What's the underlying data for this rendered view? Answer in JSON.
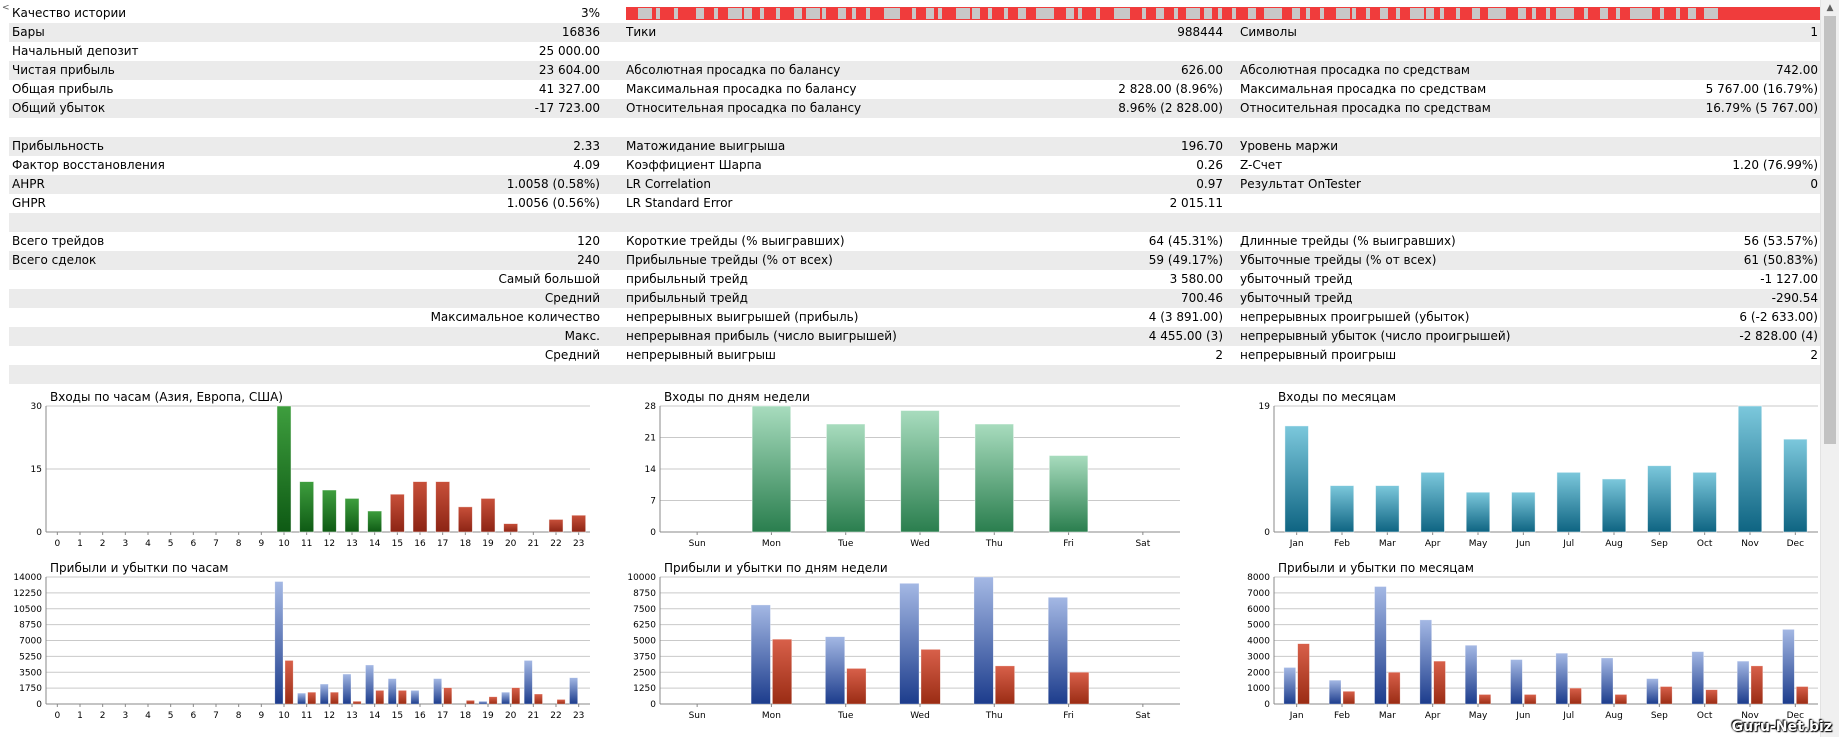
{
  "colors": {
    "quality_red": "#f03c3c",
    "quality_gray": "#c8c8c8"
  },
  "summary": {
    "history_quality_label": "Качество истории",
    "history_quality_value": "3%",
    "rows": [
      {
        "alt": true,
        "l1": "Бары",
        "v1": "16836",
        "l2": "Тики",
        "v2": "988444",
        "l3": "Символы",
        "v3": "1"
      },
      {
        "alt": false,
        "l1": "Начальный депозит",
        "v1": "25 000.00",
        "l2": "",
        "v2": "",
        "l3": "",
        "v3": ""
      },
      {
        "alt": true,
        "l1": "Чистая прибыль",
        "v1": "23 604.00",
        "l2": "Абсолютная просадка по балансу",
        "v2": "626.00",
        "l3": "Абсолютная просадка по средствам",
        "v3": "742.00"
      },
      {
        "alt": false,
        "l1": "Общая прибыль",
        "v1": "41 327.00",
        "l2": "Максимальная просадка по балансу",
        "v2": "2 828.00 (8.96%)",
        "l3": "Максимальная просадка по средствам",
        "v3": "5 767.00 (16.79%)"
      },
      {
        "alt": true,
        "l1": "Общий убыток",
        "v1": "-17 723.00",
        "l2": "Относительная просадка по балансу",
        "v2": "8.96% (2 828.00)",
        "l3": "Относительная просадка по средствам",
        "v3": "16.79% (5 767.00)"
      },
      {
        "alt": false,
        "l1": "",
        "v1": "",
        "l2": "",
        "v2": "",
        "l3": "",
        "v3": ""
      },
      {
        "alt": true,
        "l1": "Прибыльность",
        "v1": "2.33",
        "l2": "Матожидание выигрыша",
        "v2": "196.70",
        "l3": "Уровень маржи",
        "v3": ""
      },
      {
        "alt": false,
        "l1": "Фактор восстановления",
        "v1": "4.09",
        "l2": "Коэффициент Шарпа",
        "v2": "0.26",
        "l3": "Z-Счет",
        "v3": "1.20 (76.99%)"
      },
      {
        "alt": true,
        "l1": "AHPR",
        "v1": "1.0058 (0.58%)",
        "l2": "LR Correlation",
        "v2": "0.97",
        "l3": "Результат OnTester",
        "v3": "0"
      },
      {
        "alt": false,
        "l1": "GHPR",
        "v1": "1.0056 (0.56%)",
        "l2": "LR Standard Error",
        "v2": "2 015.11",
        "l3": "",
        "v3": ""
      },
      {
        "alt": true,
        "l1": "",
        "v1": "",
        "l2": "",
        "v2": "",
        "l3": "",
        "v3": ""
      },
      {
        "alt": false,
        "l1": "Всего трейдов",
        "v1": "120",
        "l2": "Короткие трейды (% выигравших)",
        "v2": "64 (45.31%)",
        "l3": "Длинные трейды (% выигравших)",
        "v3": "56 (53.57%)"
      },
      {
        "alt": true,
        "l1": "Всего сделок",
        "v1": "240",
        "l2": "Прибыльные трейды (% от всех)",
        "v2": "59 (49.17%)",
        "l3": "Убыточные трейды (% от всех)",
        "v3": "61 (50.83%)"
      },
      {
        "alt": false,
        "lr": "Самый большой",
        "l2": "прибыльный трейд",
        "v2": "3 580.00",
        "l3": "убыточный трейд",
        "v3": "-1 127.00"
      },
      {
        "alt": true,
        "lr": "Средний",
        "l2": "прибыльный трейд",
        "v2": "700.46",
        "l3": "убыточный трейд",
        "v3": "-290.54"
      },
      {
        "alt": false,
        "lr": "Максимальное количество",
        "l2": "непрерывных выигрышей (прибыль)",
        "v2": "4 (3 891.00)",
        "l3": "непрерывных проигрышей (убыток)",
        "v3": "6 (-2 633.00)"
      },
      {
        "alt": true,
        "lr": "Макс.",
        "l2": "непрерывная прибыль (число выигрышей)",
        "v2": "4 455.00 (3)",
        "l3": "непрерывный убыток (число проигрышей)",
        "v3": "-2 828.00 (4)"
      },
      {
        "alt": false,
        "lr": "Средний",
        "l2": "непрерывный выигрыш",
        "v2": "2",
        "l3": "непрерывный проигрыш",
        "v3": "2"
      },
      {
        "alt": true,
        "l1": "",
        "v1": "",
        "l2": "",
        "v2": "",
        "l3": "",
        "v3": ""
      }
    ]
  },
  "chart_data": [
    {
      "type": "bar",
      "title": "Входы по часам (Азия, Европа, США)",
      "categories": [
        "0",
        "1",
        "2",
        "3",
        "4",
        "5",
        "6",
        "7",
        "8",
        "9",
        "10",
        "11",
        "12",
        "13",
        "14",
        "15",
        "16",
        "17",
        "18",
        "19",
        "20",
        "21",
        "22",
        "23"
      ],
      "values": [
        0,
        0,
        0,
        0,
        0,
        0,
        0,
        0,
        0,
        0,
        30,
        12,
        10,
        8,
        5,
        9,
        12,
        12,
        6,
        8,
        2,
        0,
        3,
        4
      ],
      "bar_colors": [
        "green",
        "green",
        "green",
        "green",
        "green",
        "green",
        "green",
        "green",
        "green",
        "green",
        "green",
        "green",
        "green",
        "green",
        "green",
        "red",
        "red",
        "red",
        "red",
        "red",
        "red",
        "red",
        "red",
        "red"
      ],
      "yticks": [
        "0",
        "15",
        "30"
      ],
      "ylim": [
        0,
        30
      ]
    },
    {
      "type": "bar",
      "title": "Входы по дням недели",
      "categories": [
        "Sun",
        "Mon",
        "Tue",
        "Wed",
        "Thu",
        "Fri",
        "Sat"
      ],
      "values": [
        0,
        28,
        24,
        27,
        24,
        17,
        0
      ],
      "yticks": [
        "0",
        "7",
        "14",
        "21",
        "28"
      ],
      "ylim": [
        0,
        28
      ]
    },
    {
      "type": "bar",
      "title": "Входы по месяцам",
      "categories": [
        "Jan",
        "Feb",
        "Mar",
        "Apr",
        "May",
        "Jun",
        "Jul",
        "Aug",
        "Sep",
        "Oct",
        "Nov",
        "Dec"
      ],
      "values": [
        16,
        7,
        7,
        9,
        6,
        6,
        9,
        8,
        10,
        9,
        19,
        14
      ],
      "yticks": [
        "0",
        "19"
      ],
      "ylim": [
        0,
        19
      ]
    },
    {
      "type": "bar",
      "title": "Прибыли и убытки по часам",
      "categories": [
        "0",
        "1",
        "2",
        "3",
        "4",
        "5",
        "6",
        "7",
        "8",
        "9",
        "10",
        "11",
        "12",
        "13",
        "14",
        "15",
        "16",
        "17",
        "18",
        "19",
        "20",
        "21",
        "22",
        "23"
      ],
      "series": [
        {
          "values": [
            0,
            0,
            0,
            0,
            0,
            0,
            0,
            0,
            0,
            0,
            13500,
            1200,
            2200,
            3300,
            4300,
            2800,
            1500,
            2800,
            0,
            300,
            1300,
            4800,
            0,
            2900
          ]
        },
        {
          "values": [
            0,
            0,
            0,
            0,
            0,
            0,
            0,
            0,
            0,
            0,
            4800,
            1300,
            1300,
            300,
            1500,
            1500,
            0,
            1800,
            400,
            800,
            1800,
            1100,
            500,
            0
          ]
        }
      ],
      "yticks": [
        "0",
        "1750",
        "3500",
        "5250",
        "7000",
        "8750",
        "10500",
        "12250",
        "14000"
      ],
      "ylim": [
        0,
        14000
      ]
    },
    {
      "type": "bar",
      "title": "Прибыли и убытки по дням недели",
      "categories": [
        "Sun",
        "Mon",
        "Tue",
        "Wed",
        "Thu",
        "Fri",
        "Sat"
      ],
      "series": [
        {
          "values": [
            0,
            7800,
            5300,
            9500,
            10000,
            8400,
            0
          ]
        },
        {
          "values": [
            0,
            5100,
            2800,
            4300,
            3000,
            2500,
            0
          ]
        }
      ],
      "yticks": [
        "0",
        "1250",
        "2500",
        "3750",
        "5000",
        "6250",
        "7500",
        "8750",
        "10000"
      ],
      "ylim": [
        0,
        10000
      ]
    },
    {
      "type": "bar",
      "title": "Прибыли и убытки по месяцам",
      "categories": [
        "Jan",
        "Feb",
        "Mar",
        "Apr",
        "May",
        "Jun",
        "Jul",
        "Aug",
        "Sep",
        "Oct",
        "Nov",
        "Dec"
      ],
      "series": [
        {
          "values": [
            2300,
            1500,
            7400,
            5300,
            3700,
            2800,
            3200,
            2900,
            1600,
            3300,
            2700,
            4700
          ]
        },
        {
          "values": [
            3800,
            800,
            2000,
            2700,
            600,
            600,
            1000,
            600,
            1100,
            900,
            2400,
            1100
          ]
        }
      ],
      "yticks": [
        "0",
        "1000",
        "2000",
        "3000",
        "4000",
        "5000",
        "6000",
        "7000",
        "8000"
      ],
      "ylim": [
        0,
        8000
      ]
    }
  ],
  "watermark": "Guru-Net.biz"
}
